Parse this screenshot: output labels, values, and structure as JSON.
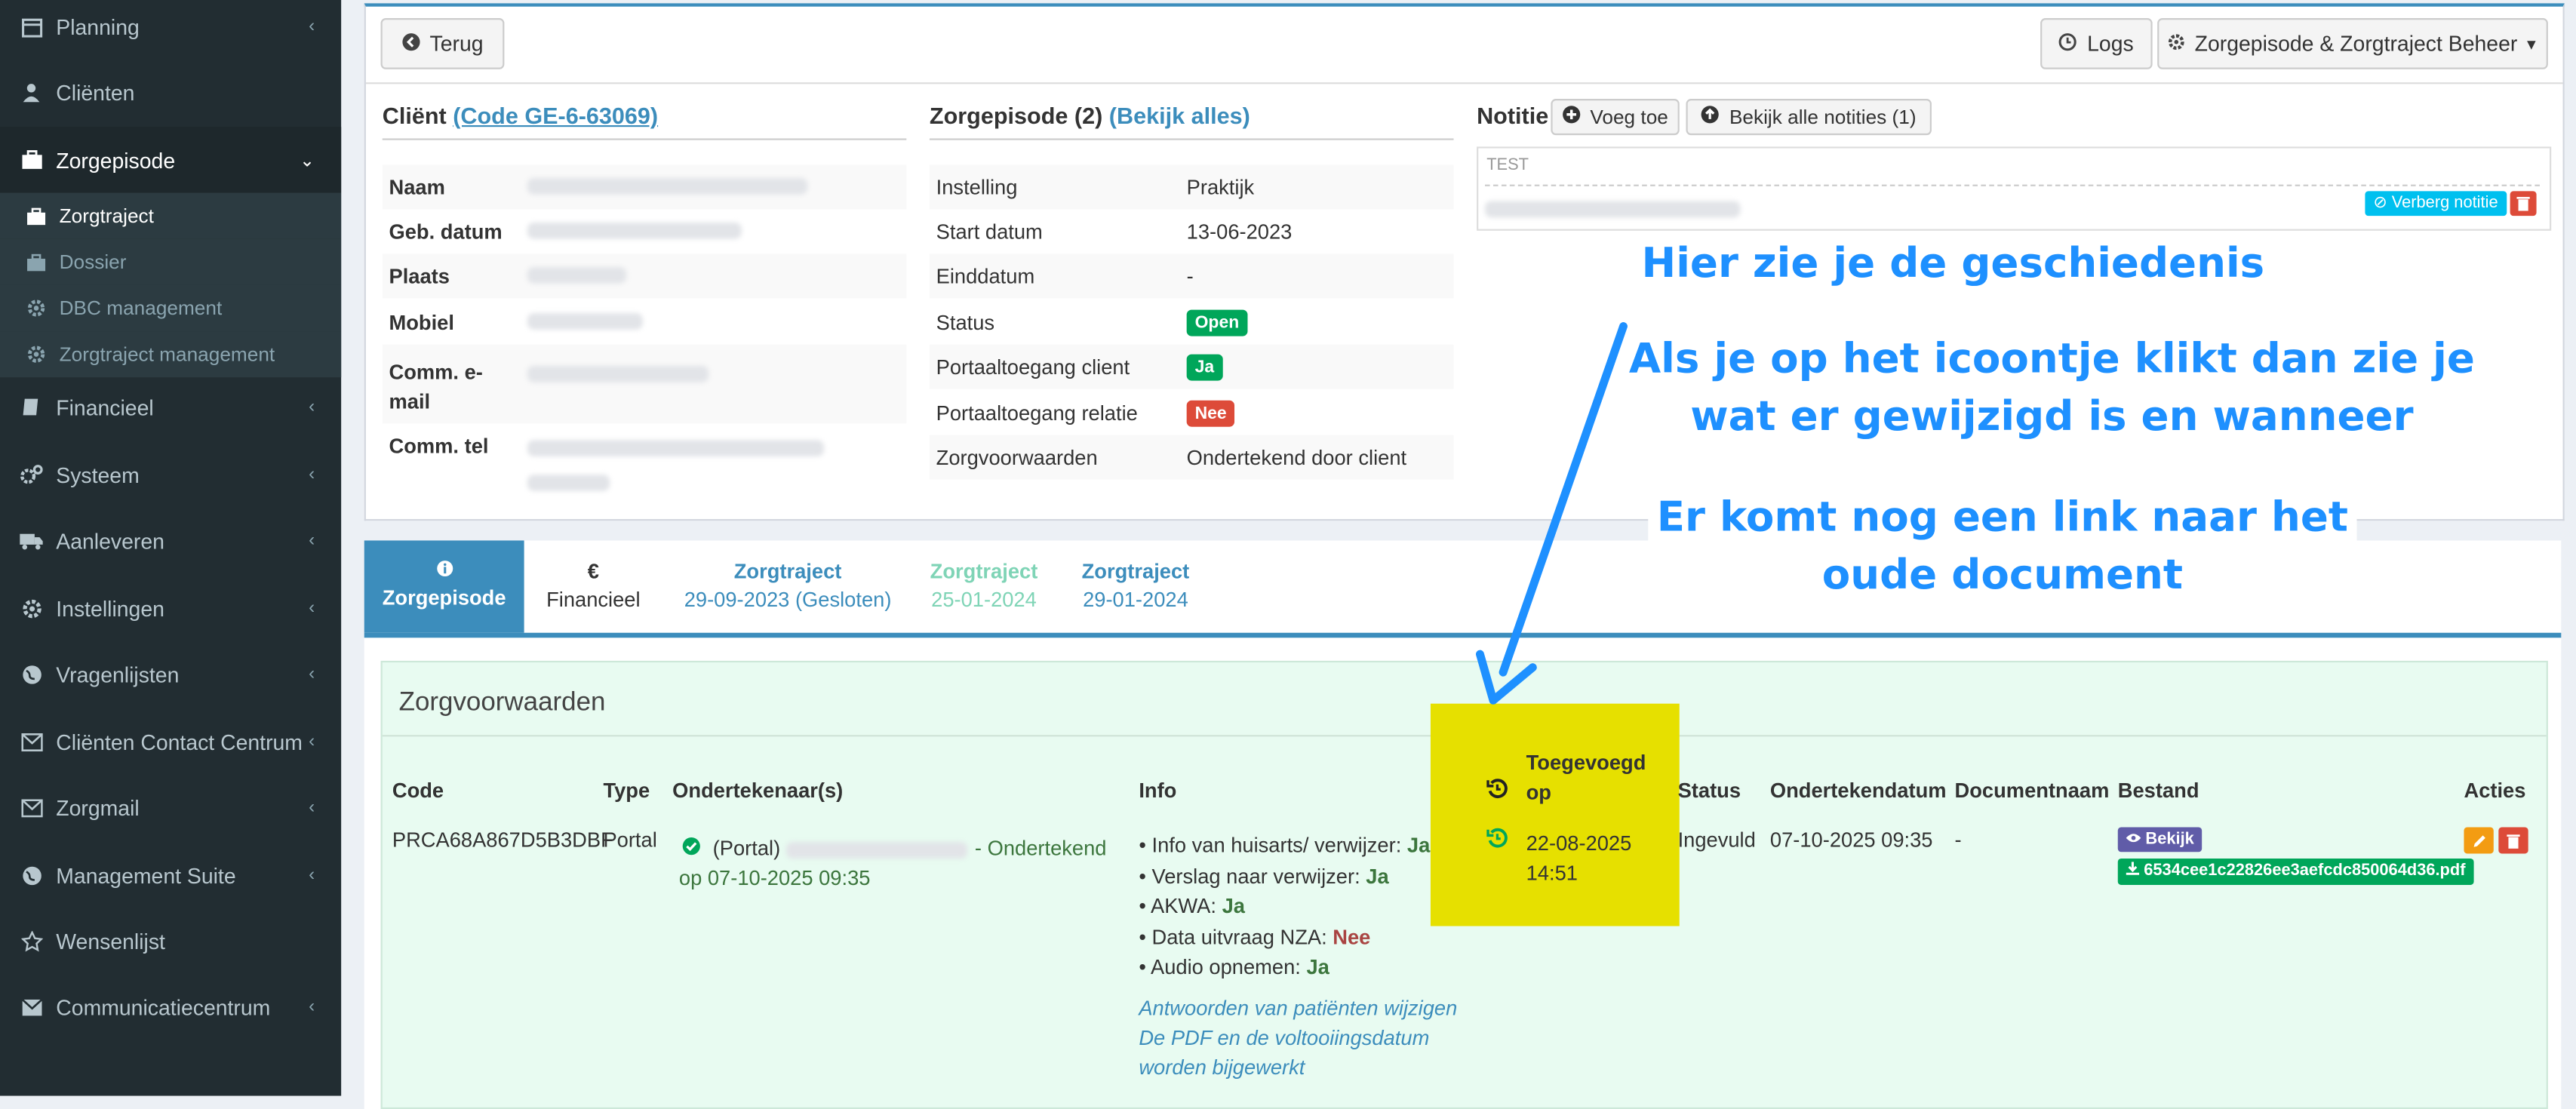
{
  "sidebar": {
    "items": [
      {
        "label": "Planning",
        "icon": "calendar-icon",
        "chevron": "‹"
      },
      {
        "label": "Cliënten",
        "icon": "user-icon",
        "chevron": ""
      },
      {
        "label": "Zorgepisode",
        "icon": "briefcase-icon",
        "chevron": "⌄"
      },
      {
        "label": "Financieel",
        "icon": "book-icon",
        "chevron": "‹"
      },
      {
        "label": "Systeem",
        "icon": "cogs-icon",
        "chevron": "‹"
      },
      {
        "label": "Aanleveren",
        "icon": "truck-icon",
        "chevron": "‹"
      },
      {
        "label": "Instellingen",
        "icon": "gear-icon",
        "chevron": "‹"
      },
      {
        "label": "Vragenlijsten",
        "icon": "globe-icon",
        "chevron": "‹"
      },
      {
        "label": "Cliënten Contact Centrum",
        "icon": "envelope-icon",
        "chevron": "‹"
      },
      {
        "label": "Zorgmail",
        "icon": "envelope-icon",
        "chevron": "‹"
      },
      {
        "label": "Management Suite",
        "icon": "globe-icon",
        "chevron": "‹"
      },
      {
        "label": "Wensenlijst",
        "icon": "star-icon",
        "chevron": ""
      },
      {
        "label": "Communicatiecentrum",
        "icon": "envelope-icon",
        "chevron": "‹"
      }
    ],
    "subitems": [
      {
        "label": "Zorgtraject",
        "icon": "briefcase-icon"
      },
      {
        "label": "Dossier",
        "icon": "briefcase-icon"
      },
      {
        "label": "DBC management",
        "icon": "gear-icon"
      },
      {
        "label": "Zorgtraject management",
        "icon": "gear-icon"
      }
    ]
  },
  "toolbar": {
    "back": "Terug",
    "logs": "Logs",
    "beheer": "Zorgepisode & Zorgtraject Beheer"
  },
  "client": {
    "title": "Cliënt",
    "code_link": "(Code GE-6-63069)",
    "labels": [
      "Naam",
      "Geb. datum",
      "Plaats",
      "Mobiel",
      "Comm. e-mail",
      "Comm. tel"
    ]
  },
  "episode": {
    "title": "Zorgepisode (2)",
    "link": "(Bekijk alles)",
    "rows": [
      {
        "label": "Instelling",
        "value": "Praktijk",
        "badge": ""
      },
      {
        "label": "Start datum",
        "value": "13-06-2023",
        "badge": ""
      },
      {
        "label": "Einddatum",
        "value": "-",
        "badge": ""
      },
      {
        "label": "Status",
        "value": "",
        "badge": "Open"
      },
      {
        "label": "Portaaltoegang client",
        "value": "",
        "badge": "Ja"
      },
      {
        "label": "Portaaltoegang relatie",
        "value": "",
        "badge": "Nee"
      },
      {
        "label": "Zorgvoorwaarden",
        "value": "Ondertekend door client",
        "badge": ""
      }
    ]
  },
  "notitie": {
    "title": "Notitie",
    "add": "Voeg toe",
    "view_all": "Bekijk alle notities (1)",
    "note_title": "TEST",
    "hide": "Verberg notitie"
  },
  "tabs": [
    {
      "line1": "Zorgepisode",
      "line2": "",
      "icon": "info-icon"
    },
    {
      "line1": "€",
      "line2": "Financieel",
      "icon": ""
    },
    {
      "line1": "Zorgtraject",
      "line2": "29-09-2023 (Gesloten)",
      "icon": ""
    },
    {
      "line1": "Zorgtraject",
      "line2": "25-01-2024",
      "icon": ""
    },
    {
      "line1": "Zorgtraject",
      "line2": "29-01-2024",
      "icon": ""
    }
  ],
  "zorgvoorwaarden": {
    "title": "Zorgvoorwaarden",
    "headers": [
      "Code",
      "Type",
      "Ondertekenaar(s)",
      "Info",
      "Toegevoegd op",
      "Status",
      "Ondertekendatum",
      "Documentnaam",
      "Bestand",
      "Acties"
    ],
    "row": {
      "code": "PRCA68A867D5B3DBF",
      "type": "Portal",
      "signer_prefix": "(Portal)",
      "signed_text": "- Ondertekend",
      "signed_on": "op 07-10-2025 09:35",
      "info": [
        {
          "label": "Info van huisarts/ verwijzer:",
          "value": "Ja"
        },
        {
          "label": "Verslag naar verwijzer:",
          "value": "Ja"
        },
        {
          "label": "AKWA:",
          "value": "Ja"
        },
        {
          "label": "Data uitvraag NZA:",
          "value": "Nee"
        },
        {
          "label": "Audio opnemen:",
          "value": "Ja"
        }
      ],
      "note_line1": "Antwoorden van patiënten wijzigen",
      "note_line2": "De PDF en de voltooiingsdatum",
      "note_line3": "worden bijgewerkt",
      "added_date": "22-08-2025",
      "added_time": "14:51",
      "status": "Ingevuld",
      "signed_date": "07-10-2025 09:35",
      "docname": "-",
      "view_btn": "Bekijk",
      "file": "6534cee1c22826ee3aefcdc850064d36.pdf"
    }
  },
  "annotations": {
    "line1": "Hier zie je de geschiedenis",
    "line2a": "Als je op het icoontje klikt dan zie je",
    "line2b": "wat er gewijzigd is en wanneer",
    "line3a": "Er komt nog een link naar het",
    "line3b": "oude document"
  },
  "colors": {
    "sidebar_bg": "#222d32",
    "accent": "#3c8dbc",
    "highlight": "#e6e000",
    "panel_bg": "#e8fbf1",
    "annotation": "#1e90ff"
  }
}
